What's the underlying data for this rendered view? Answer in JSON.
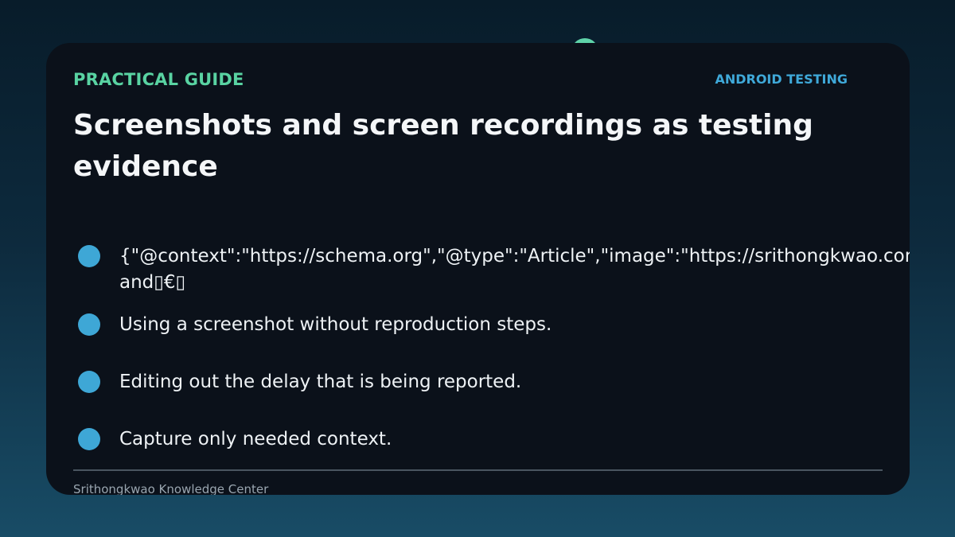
{
  "header": {
    "eyebrow": "PRACTICAL GUIDE",
    "tag": "ANDROID TESTING",
    "title": "Screenshots and screen recordings as testing evidence"
  },
  "list": {
    "items": [
      {
        "line1": "{\"@context\":\"https://schema.org\",\"@type\":\"Article\",\"image\":\"https://srithongkwao.com/g",
        "line2": "and▯€▯"
      },
      {
        "text": "Using a screenshot without reproduction steps."
      },
      {
        "text": "Editing out the delay that is being reported."
      },
      {
        "text": "Capture only needed context."
      }
    ]
  },
  "footer": {
    "text": "Srithongkwao Knowledge Center"
  },
  "colors": {
    "accent_green": "#59d3a2",
    "accent_blue": "#3fa9d9",
    "card_background": "#0b111a"
  }
}
